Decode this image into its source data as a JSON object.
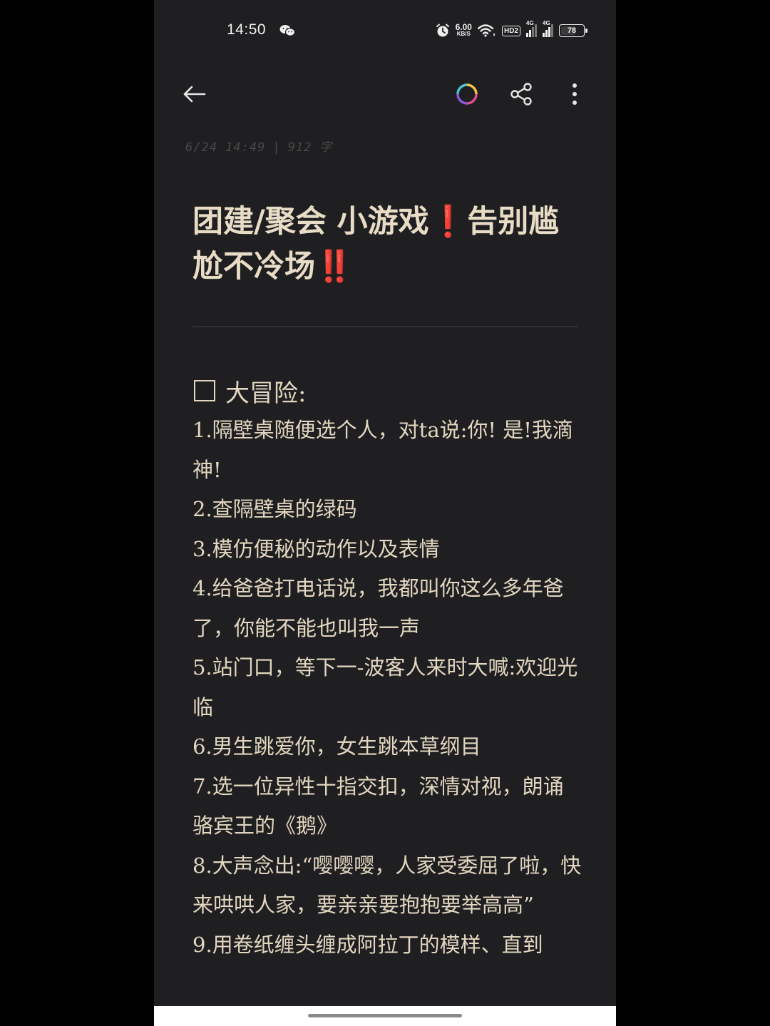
{
  "status_bar": {
    "time": "14:50",
    "net_speed_value": "6.00",
    "net_speed_unit": "KB/S",
    "hd_badge": "HD2",
    "sim1_network": "4G",
    "sim2_network": "4G",
    "battery_level": "78",
    "battery_fraction": 0.78,
    "icons": [
      "wechat-icon",
      "alarm-icon",
      "wifi-icon",
      "signal-icon",
      "battery-icon"
    ]
  },
  "toolbar": {
    "icons": [
      "back-arrow-icon",
      "color-ring-icon",
      "share-icon",
      "more-vertical-icon"
    ]
  },
  "note": {
    "timestamp": "6/24 14:49",
    "word_count": "912 字",
    "title_part1": "团建/聚会 小游戏",
    "title_mark1": "❗",
    "title_part2": "告别尴尬不冷场",
    "title_mark2": "‼️",
    "section_title": "大冒险:",
    "items": [
      "1.隔壁桌随便选个人，对ta说:你! 是!我滴神!",
      "2.查隔壁桌的绿码",
      "3.模仿便秘的动作以及表情",
      "4.给爸爸打电话说，我都叫你这么多年爸了，你能不能也叫我一声",
      "5.站门口，等下一-波客人来时大喊:欢迎光临",
      "6.男生跳爱你，女生跳本草纲目",
      "7.选一位异性十指交扣，深情对视，朗诵骆宾王的《鹅》",
      "8.大声念出:“嘤嘤嘤，人家受委屈了啦，快来哄哄人家，要亲亲要抱抱要举高高”",
      "9.用卷纸缠头缠成阿拉丁的模样、直到"
    ]
  },
  "colors": {
    "background": "#1f1f21",
    "text": "#e2d6c0",
    "accent_red": "#e23a3a"
  }
}
